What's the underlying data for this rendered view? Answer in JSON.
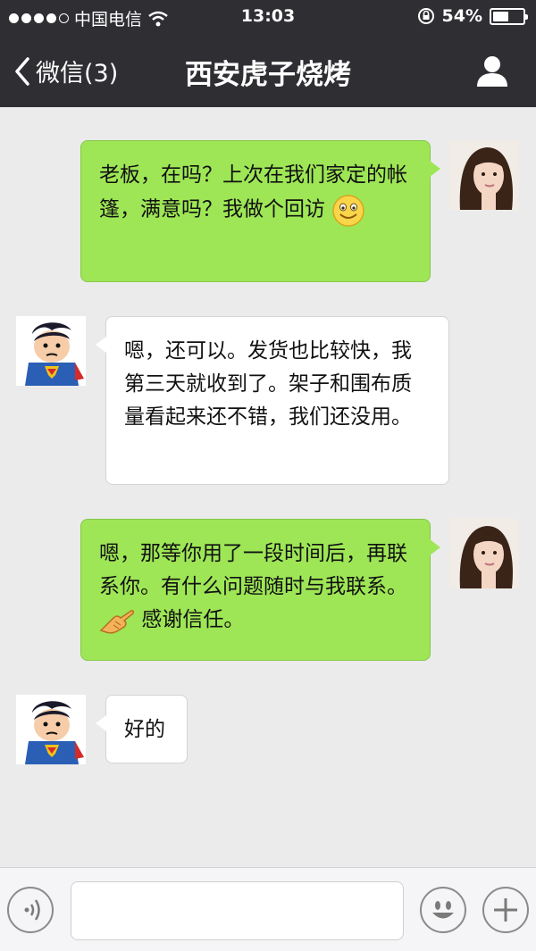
{
  "status_bar": {
    "carrier": "中国电信",
    "time": "13:03",
    "battery_percent": "54%",
    "battery_level": 0.54,
    "signal_dots_filled": 4,
    "signal_dots_total": 5
  },
  "nav": {
    "back_label": "微信(3)",
    "title": "西安虎子烧烤"
  },
  "messages": [
    {
      "sender": "me",
      "text": "老板，在吗？上次在我们家定的帐篷，满意吗？我做个回访",
      "emoji": "smiley"
    },
    {
      "sender": "them",
      "text": "嗯，还可以。发货也比较快，我第三天就收到了。架子和围布质量看起来还不错，我们还没用。"
    },
    {
      "sender": "me",
      "text_before": "嗯，那等你用了一段时间后，再联系你。有什么问题随时与我联系。",
      "emoji": "pointing-hand",
      "text_after": "感谢信任。"
    },
    {
      "sender": "them",
      "text": "好的"
    }
  ],
  "input": {
    "value": ""
  },
  "icons": {
    "back": "chevron-left-icon",
    "profile": "person-icon",
    "voice": "voice-icon",
    "emoji": "emoji-icon",
    "more": "plus-icon"
  },
  "colors": {
    "header_bg": "#2e2e33",
    "chat_bg": "#ebebeb",
    "my_bubble": "#9ee656",
    "their_bubble": "#ffffff"
  }
}
